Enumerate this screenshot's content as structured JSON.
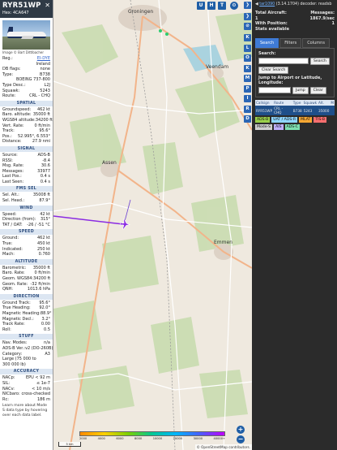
{
  "panel": {
    "callsign": "RYR51WP",
    "hex_line": "Hex: 4CA647",
    "close": "✕",
    "photo_credit": "Image © Bart Dittlbacher",
    "summary": [
      {
        "k": "Reg.:",
        "v": "EI-DYE",
        "link": true
      },
      {
        "k": "",
        "v": "Ireland"
      },
      {
        "k": "DB flags:",
        "v": "none"
      },
      {
        "k": "Type:",
        "v": "B738"
      },
      {
        "k": "",
        "v": "BOEING 737-800"
      },
      {
        "k": "Type Desc.:",
        "v": "L2J"
      },
      {
        "k": "Squawk:",
        "v": "5243"
      },
      {
        "k": "Route:",
        "v": "CRL - CHQ"
      }
    ],
    "sections": [
      {
        "title": "SPATIAL",
        "rows": [
          {
            "k": "Groundspeed:",
            "v": "462 kt"
          },
          {
            "k": "Baro. altitude:",
            "v": "35000 ft"
          },
          {
            "k": "WGS84 altitude:",
            "v": "34200 ft"
          },
          {
            "k": "Vert. Rate:",
            "v": "0 ft/min"
          },
          {
            "k": "Track:",
            "v": "95.6°"
          },
          {
            "k": "Pos.:",
            "v": "52.995°, 6.553°"
          },
          {
            "k": "Distance:",
            "v": "27.9 nmi"
          }
        ]
      },
      {
        "title": "SIGNAL",
        "rows": [
          {
            "k": "Source:",
            "v": "ADS-B"
          },
          {
            "k": "RSSI:",
            "v": "-8.4"
          },
          {
            "k": "Msg. Rate:",
            "v": "30.6"
          },
          {
            "k": "Messages:",
            "v": "33977"
          },
          {
            "k": "",
            "v": ""
          },
          {
            "k": "Last Pos.:",
            "v": "0.4 s"
          },
          {
            "k": "Last Seen:",
            "v": "0.4 s"
          }
        ]
      },
      {
        "title": "FMS SEL",
        "rows": [
          {
            "k": "Sel. Alt.:",
            "v": "35008 ft"
          },
          {
            "k": "Sel. Head.:",
            "v": "87.9°"
          }
        ]
      },
      {
        "title": "WIND",
        "rows": [
          {
            "k": "Speed:",
            "v": "42 kt"
          },
          {
            "k": "Direction (from):",
            "v": "315°"
          },
          {
            "k": "TAT / OAT:",
            "v": "-26 / -51 °C"
          }
        ]
      },
      {
        "title": "SPEED",
        "rows": [
          {
            "k": "Ground:",
            "v": "462 kt"
          },
          {
            "k": "True:",
            "v": "450 kt"
          },
          {
            "k": "Indicated:",
            "v": "250 kt"
          },
          {
            "k": "Mach:",
            "v": "0.760"
          }
        ]
      },
      {
        "title": "ALTITUDE",
        "rows": [
          {
            "k": "Barometric:",
            "v": "35000 ft"
          },
          {
            "k": "Baro. Rate:",
            "v": "0 ft/min"
          },
          {
            "k": "Geom. WGS84:",
            "v": "34200 ft"
          },
          {
            "k": "Geom. Rate:",
            "v": "-32 ft/min"
          },
          {
            "k": "QNH:",
            "v": "1013.6 hPa"
          }
        ]
      },
      {
        "title": "DIRECTION",
        "rows": [
          {
            "k": "Ground Track:",
            "v": "95.6°"
          },
          {
            "k": "True Heading:",
            "v": "92.0°"
          },
          {
            "k": "Magnetic Heading:",
            "v": "88.9°"
          },
          {
            "k": "Magnetic Decl.:",
            "v": "3.2°"
          },
          {
            "k": "Track Rate:",
            "v": "0.00"
          },
          {
            "k": "Roll:",
            "v": "0.5"
          }
        ]
      },
      {
        "title": "STUFF",
        "rows": [
          {
            "k": "Nav. Modes:",
            "v": "n/a"
          },
          {
            "k": "ADS-B Ver.:",
            "v": "v2 (DO-260B)"
          },
          {
            "k": "Category:",
            "v": "A3"
          },
          {
            "k": "Large (75 000 to",
            "v": ""
          },
          {
            "k": "300 000 lb)",
            "v": ""
          }
        ]
      },
      {
        "title": "ACCURACY",
        "rows": [
          {
            "k": "NACp:",
            "v": "EPU < 92 m"
          },
          {
            "k": "SIL:",
            "v": "≤ 1e-7"
          },
          {
            "k": "NACv:",
            "v": "< 10 m/s"
          },
          {
            "k": "NICbaro:",
            "v": "cross-checked"
          },
          {
            "k": "Rc:",
            "v": "186 m"
          }
        ]
      }
    ],
    "footer": "Learn more about Mode S data type by hovering over each data label."
  },
  "map": {
    "top_buttons": [
      "U",
      "H",
      "T"
    ],
    "side_buttons": [
      "K",
      "L",
      "O",
      "K",
      "M",
      "P",
      "I",
      "R",
      "D"
    ],
    "places": [
      {
        "name": "Groningen"
      },
      {
        "name": "Assen"
      },
      {
        "name": "Veendam"
      },
      {
        "name": "Emmen"
      }
    ],
    "legend": [
      "2000",
      "4000",
      "6000",
      "8000",
      "10000",
      "20000",
      "30000",
      "40000+"
    ],
    "scale": "5 km",
    "zoom_in": "+",
    "zoom_out": "−",
    "attribution": "© OpenStreetMap contributors."
  },
  "right": {
    "top_prefix": "◀",
    "version_link": "tar1090",
    "version_text": "(3.14.1704) decoder: readsb",
    "stats": [
      {
        "k": "Total Aircraft:",
        "v": "1"
      },
      {
        "k": "With Position:",
        "v": "1"
      },
      {
        "k": "Messages:",
        "v": "1867.9/sec"
      },
      {
        "k": "Stats available",
        "v": ""
      }
    ],
    "tabs": [
      "Search",
      "Filters",
      "Columns"
    ],
    "search_label": "Search:",
    "search_button": "Search",
    "clear_search": "Clear Search",
    "jump_label": "Jump to Airport or Latitude, Longitude:",
    "jump_button": "Jump",
    "clear_button": "Clear",
    "table": {
      "headers": [
        "Callsign",
        "Route",
        "Type",
        "Squawk",
        "Alt.",
        "M"
      ],
      "rows": [
        [
          "RYR51WP",
          "CRL - CHQ",
          "B738",
          "5243",
          "35000",
          ""
        ]
      ]
    },
    "source_tags": [
      {
        "label": "ADS-B",
        "color": "#9ad04b"
      },
      {
        "label": "UAT / ADS-R",
        "color": "#8fd6ff"
      },
      {
        "label": "MLAT",
        "color": "#f7a733"
      },
      {
        "label": "TIS-B",
        "color": "#ff6f6f"
      },
      {
        "label": "Mode-S",
        "color": "#d0d0d0"
      },
      {
        "label": "AIS",
        "color": "#c0b0ff"
      },
      {
        "label": "ADS-C",
        "color": "#7ee0b0"
      }
    ]
  }
}
